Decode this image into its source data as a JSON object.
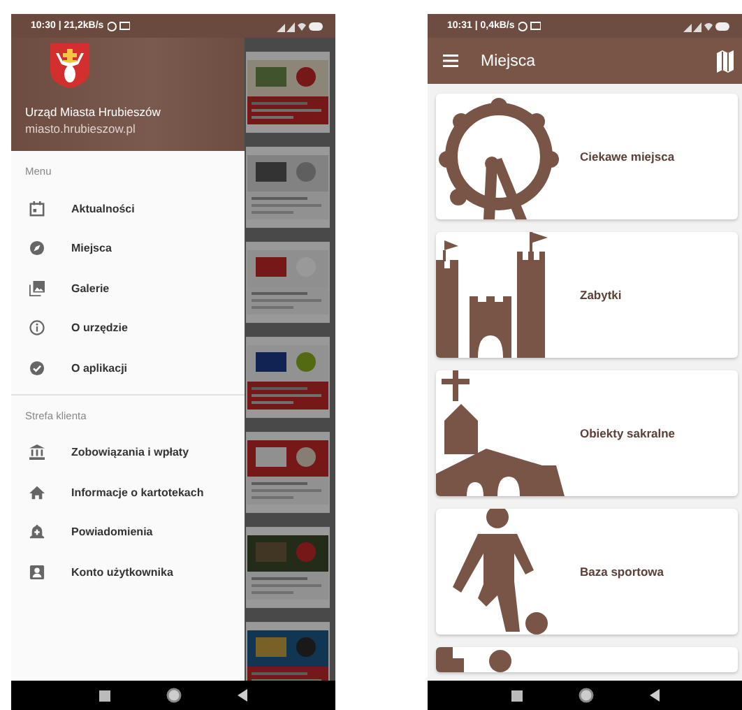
{
  "left_phone": {
    "status_bar": {
      "time": "10:30 | 21,2kB/s"
    },
    "drawer": {
      "title": "Urząd Miasta Hrubieszów",
      "subtitle": "miasto.hrubieszow.pl",
      "sections": [
        {
          "heading": "Menu",
          "items": [
            {
              "label": "Aktualności"
            },
            {
              "label": "Miejsca"
            },
            {
              "label": "Galerie"
            },
            {
              "label": "O urzędzie"
            },
            {
              "label": "O aplikacji"
            }
          ]
        },
        {
          "heading": "Strefa klienta",
          "items": [
            {
              "label": "Zobowiązania i wpłaty"
            },
            {
              "label": "Informacje o kartotekach"
            },
            {
              "label": "Powiadomienia"
            },
            {
              "label": "Konto użytkownika"
            }
          ]
        }
      ]
    }
  },
  "right_phone": {
    "status_bar": {
      "time": "10:31 | 0,4kB/s"
    },
    "app_bar": {
      "title": "Miejsca"
    },
    "categories": [
      {
        "label": "Ciekawe miejsca"
      },
      {
        "label": "Zabytki"
      },
      {
        "label": "Obiekty sakralne"
      },
      {
        "label": "Baza sportowa"
      }
    ]
  }
}
